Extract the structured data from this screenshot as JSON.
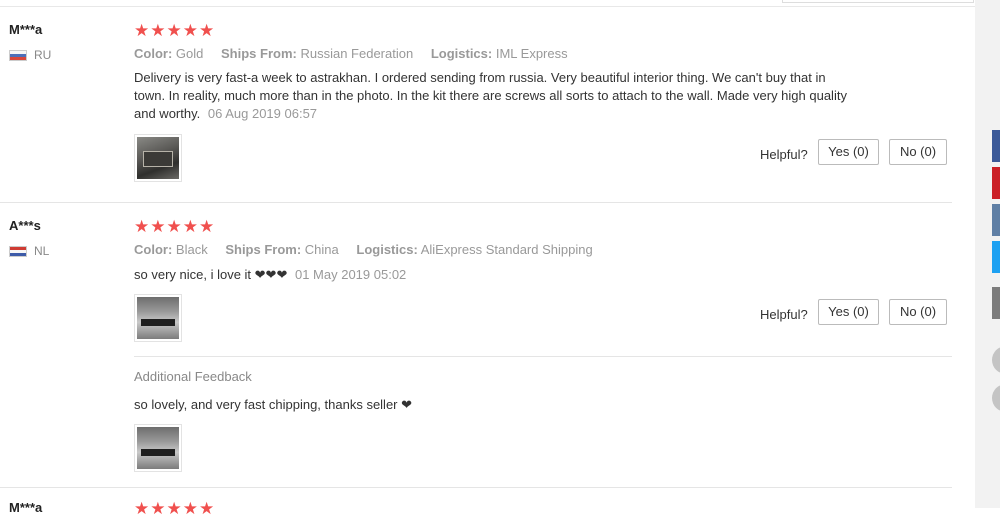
{
  "reviews": [
    {
      "user": "M***a",
      "country": "RU",
      "stars": "★★★★★",
      "color_label": "Color:",
      "color_value": "Gold",
      "ships_label": "Ships From:",
      "ships_value": "Russian Federation",
      "logistics_label": "Logistics:",
      "logistics_value": "IML Express",
      "text": "Delivery is very fast-a week to astrakhan. I ordered sending from russia. Very beautiful interior thing. We can't buy that in town. In reality, much more than in the photo. In the kit there are screws all sorts to attach to the wall. Made very high quality and worthy.",
      "date": "06 Aug 2019 06:57",
      "helpful_label": "Helpful?",
      "yes_label": "Yes (0)",
      "no_label": "No (0)"
    },
    {
      "user": "A***s",
      "country": "NL",
      "stars": "★★★★★",
      "color_label": "Color:",
      "color_value": "Black",
      "ships_label": "Ships From:",
      "ships_value": "China",
      "logistics_label": "Logistics:",
      "logistics_value": "AliExpress Standard Shipping",
      "text": "so very nice, i love it ❤❤❤",
      "date": "01 May 2019 05:02",
      "helpful_label": "Helpful?",
      "yes_label": "Yes (0)",
      "no_label": "No (0)",
      "additional_title": "Additional Feedback",
      "additional_text": "so lovely, and very fast chipping, thanks seller ❤"
    },
    {
      "user": "M***a",
      "stars": "★★★★★"
    }
  ],
  "colors": {
    "star": "#f0504e",
    "muted": "#999999",
    "side_tabs": [
      "#3b5998",
      "#cb2027",
      "#5f7fa5",
      "#1da1f2",
      "#7c7c7c"
    ]
  }
}
